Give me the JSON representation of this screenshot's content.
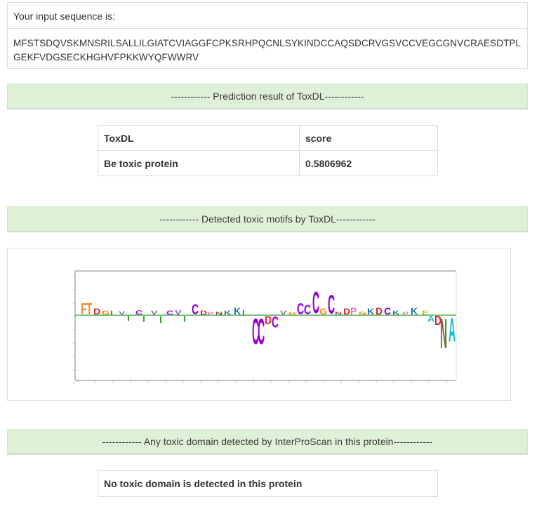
{
  "input": {
    "label": "Your input sequence is:",
    "sequence": "MFSTSDQVSKMNSRILSALLILGIATCVIAGGFCPKSRHPQCNLSYKINDCCAQSDCRVGSVCCVEGCGNVCRAESDTPLGEKFVDGSECKHGHVFPKKWYQFWWRV"
  },
  "prediction": {
    "banner": "------------ Prediction result of ToxDL------------",
    "header": [
      "ToxDL",
      "score"
    ],
    "row": [
      "Be toxic protein",
      "0.5806962"
    ]
  },
  "motifs": {
    "banner": "------------ Detected toxic motifs by ToxDL------------",
    "logo_glyphs": [
      {
        "ch": "F",
        "color": "#f08c2a"
      },
      {
        "ch": "T",
        "color": "#f08c2a"
      },
      {
        "ch": "D",
        "color": "#d62728"
      },
      {
        "ch": "G",
        "color": "#ff7f0e"
      },
      {
        "ch": "I",
        "color": "#2ca02c"
      },
      {
        "ch": "V",
        "color": "#9467bd"
      },
      {
        "ch": "C",
        "color": "#9400d3"
      },
      {
        "ch": "K",
        "color": "#1f77b4"
      },
      {
        "ch": "P",
        "color": "#e377c2"
      },
      {
        "ch": "N",
        "color": "#8c564b"
      },
      {
        "ch": "A",
        "color": "#17becf"
      },
      {
        "ch": "E",
        "color": "#bcbd22"
      }
    ]
  },
  "domain": {
    "banner": "------------ Any toxic domain detected by InterProScan in this protein------------",
    "message": "No toxic domain is detected in this protein"
  }
}
